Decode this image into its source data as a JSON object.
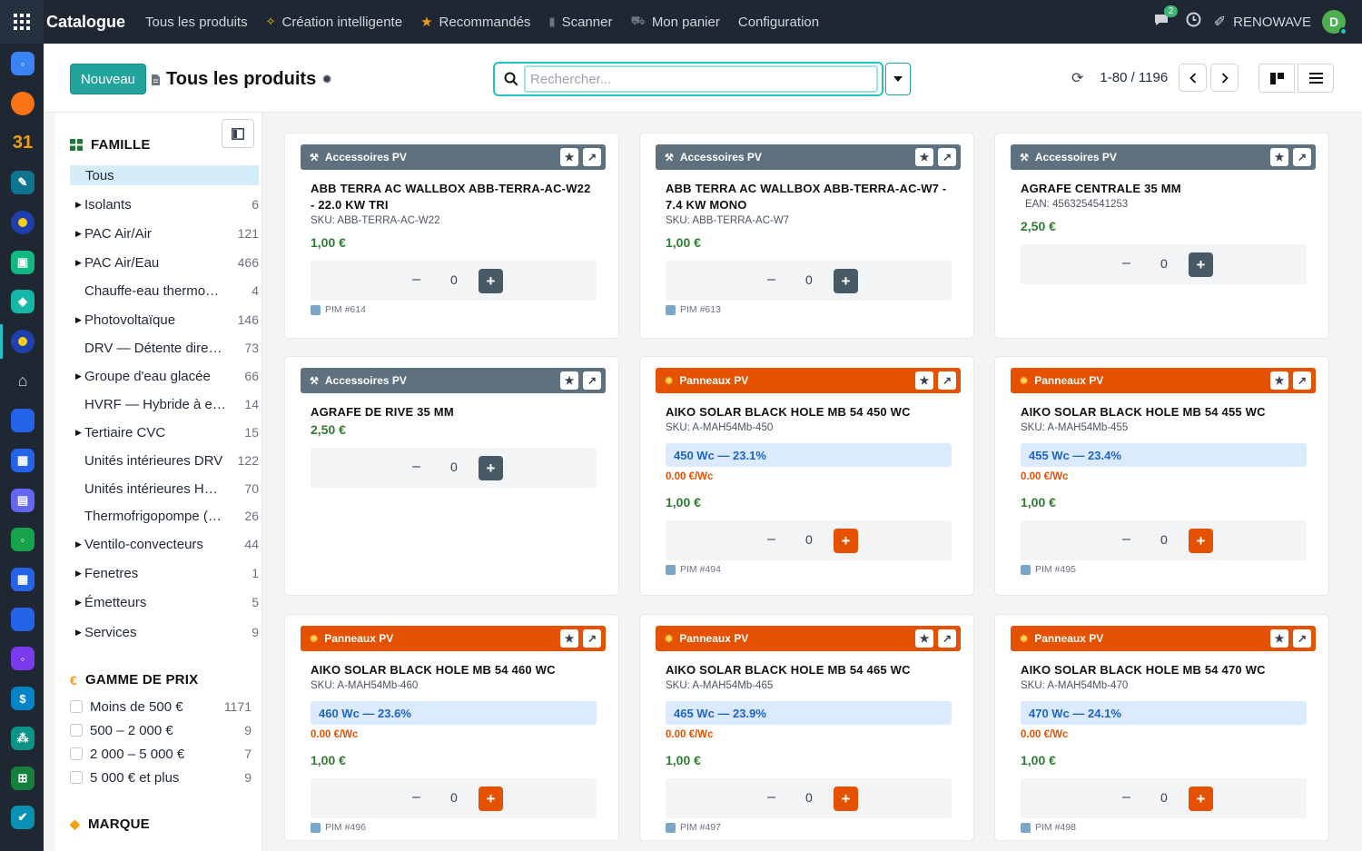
{
  "app": {
    "name": "Catalogue",
    "menu": [
      {
        "label": "Tous les produits",
        "icon": ""
      },
      {
        "label": "Création intelligente",
        "icon": "sparkle-icon"
      },
      {
        "label": "Recommandés",
        "icon": "star-icon"
      },
      {
        "label": "Scanner",
        "icon": "barcode-icon"
      },
      {
        "label": "Mon panier",
        "icon": "cart-icon"
      },
      {
        "label": "Configuration",
        "icon": ""
      }
    ],
    "chat_badge": "2",
    "company": "RENOWAVE",
    "avatar_letter": "D"
  },
  "control": {
    "new_button": "Nouveau",
    "page_title": "Tous les produits",
    "search_placeholder": "Rechercher...",
    "pager_value": "1-80 / 1196"
  },
  "sidebar": {
    "famille_title": "FAMILLE",
    "famille": [
      {
        "label": "Tous",
        "count": "",
        "caret": false,
        "active": true
      },
      {
        "label": "Isolants",
        "count": "6",
        "caret": true
      },
      {
        "label": "PAC Air/Air",
        "count": "121",
        "caret": true
      },
      {
        "label": "PAC Air/Eau",
        "count": "466",
        "caret": true
      },
      {
        "label": "Chauffe-eau thermodynamique",
        "count": "4",
        "caret": false
      },
      {
        "label": "Photovoltaïque",
        "count": "146",
        "caret": true
      },
      {
        "label": "DRV — Détente directe",
        "count": "73",
        "caret": false
      },
      {
        "label": "Groupe d'eau glacée",
        "count": "66",
        "caret": true
      },
      {
        "label": "HVRF — Hybride à eau",
        "count": "14",
        "caret": false
      },
      {
        "label": "Tertiaire CVC",
        "count": "15",
        "caret": true
      },
      {
        "label": "Unités intérieures DRV",
        "count": "122",
        "caret": false
      },
      {
        "label": "Unités intérieures HVRF",
        "count": "70",
        "caret": false
      },
      {
        "label": "Thermofrigopompe (THP)",
        "count": "26",
        "caret": false
      },
      {
        "label": "Ventilo-convecteurs",
        "count": "44",
        "caret": true
      },
      {
        "label": "Fenetres",
        "count": "1",
        "caret": true
      },
      {
        "label": "Émetteurs",
        "count": "5",
        "caret": true
      },
      {
        "label": "Services",
        "count": "9",
        "caret": true
      }
    ],
    "prix_title": "GAMME DE PRIX",
    "prix": [
      {
        "label": "Moins de 500 €",
        "count": "1171"
      },
      {
        "label": "500 – 2 000 €",
        "count": "9"
      },
      {
        "label": "2 000 – 5 000 €",
        "count": "7"
      },
      {
        "label": "5 000 € et plus",
        "count": "9"
      }
    ],
    "marque_title": "MARQUE"
  },
  "colors": {
    "accent": "#22a39b",
    "category_grey": "#5f717e",
    "category_orange": "#e65100",
    "price_green": "#2e7d32",
    "power_blue": "#1d64c7"
  },
  "cards": [
    {
      "category": "Accessoires PV",
      "name": "ABB TERRA AC WALLBOX ABB-TERRA-AC-W22 - 22.0 KW TRI",
      "code": "SKU: ABB-TERRA-AC-W22",
      "power": "",
      "ppw": "",
      "price": "1,00 €",
      "qty": "0",
      "pim": "PIM #614"
    },
    {
      "category": "Accessoires PV",
      "name": "ABB TERRA AC WALLBOX ABB-TERRA-AC-W7 - 7.4 KW MONO",
      "code": "SKU: ABB-TERRA-AC-W7",
      "power": "",
      "ppw": "",
      "price": "1,00 €",
      "qty": "0",
      "pim": "PIM #613"
    },
    {
      "category": "Accessoires PV",
      "name": "AGRAFE CENTRALE 35 MM",
      "code": "EAN: 4563254541253",
      "power": "",
      "ppw": "",
      "price": "2,50 €",
      "qty": "0",
      "pim": ""
    },
    {
      "category": "Accessoires PV",
      "name": "AGRAFE DE RIVE 35 MM",
      "code": "",
      "power": "",
      "ppw": "",
      "price": "2,50 €",
      "qty": "0",
      "pim": ""
    },
    {
      "category": "Panneaux PV",
      "name": "AIKO SOLAR BLACK HOLE MB 54 450 WC",
      "code": "SKU: A-MAH54Mb-450",
      "power": "450 Wc — 23.1%",
      "ppw": "0.00 €/Wc",
      "price": "1,00 €",
      "qty": "0",
      "pim": "PIM #494"
    },
    {
      "category": "Panneaux PV",
      "name": "AIKO SOLAR BLACK HOLE MB 54 455 WC",
      "code": "SKU: A-MAH54Mb-455",
      "power": "455 Wc — 23.4%",
      "ppw": "0.00 €/Wc",
      "price": "1,00 €",
      "qty": "0",
      "pim": "PIM #495"
    },
    {
      "category": "Panneaux PV",
      "name": "AIKO SOLAR BLACK HOLE MB 54 460 WC",
      "code": "SKU: A-MAH54Mb-460",
      "power": "460 Wc — 23.6%",
      "ppw": "0.00 €/Wc",
      "price": "1,00 €",
      "qty": "0",
      "pim": "PIM #496"
    },
    {
      "category": "Panneaux PV",
      "name": "AIKO SOLAR BLACK HOLE MB 54 465 WC",
      "code": "SKU: A-MAH54Mb-465",
      "power": "465 Wc — 23.9%",
      "ppw": "0.00 €/Wc",
      "price": "1,00 €",
      "qty": "0",
      "pim": "PIM #497"
    },
    {
      "category": "Panneaux PV",
      "name": "AIKO SOLAR BLACK HOLE MB 54 470 WC",
      "code": "SKU: A-MAH54Mb-470",
      "power": "470 Wc — 24.1%",
      "ppw": "0.00 €/Wc",
      "price": "1,00 €",
      "qty": "0",
      "pim": "PIM #498"
    }
  ]
}
